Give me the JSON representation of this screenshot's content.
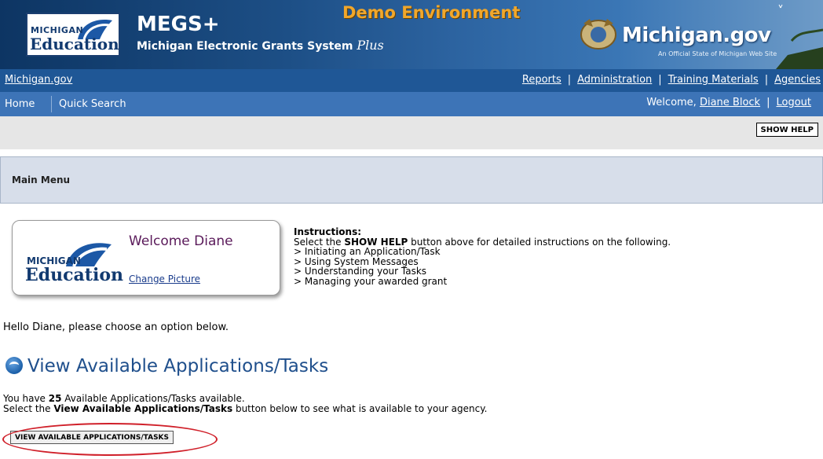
{
  "banner": {
    "mde_logo_top": "MICHIGAN",
    "mde_logo_bottom": "Education",
    "app_title": "MEGS+",
    "app_subtitle": "Michigan Electronic Grants System",
    "app_subtitle_plus": "Plus",
    "environment": "Demo Environment",
    "michigan_gov_logo": "Michigan.gov",
    "michigan_gov_tagline": "An Official State of Michigan Web Site"
  },
  "topnav": {
    "left_link": "Michigan.gov",
    "links": [
      "Reports",
      "Administration",
      "Training Materials",
      "Agencies"
    ],
    "separator": "|"
  },
  "subnav": {
    "home": "Home",
    "quick_search": "Quick Search",
    "welcome_prefix": "Welcome,",
    "user_name": "Diane Block",
    "logout": "Logout",
    "separator": "|"
  },
  "help": {
    "show_help_label": "SHOW HELP"
  },
  "main_menu": {
    "title": "Main Menu"
  },
  "welcome_card": {
    "logo_top": "MICHIGAN",
    "logo_bottom": "Education",
    "greeting": "Welcome Diane",
    "change_picture": "Change Picture"
  },
  "instructions": {
    "heading": "Instructions:",
    "line_pre": "Select the ",
    "line_bold": "SHOW HELP",
    "line_post": " button above for detailed instructions on the following.",
    "items": [
      "> Initiating an Application/Task",
      "> Using System Messages",
      "> Understanding your Tasks",
      "> Managing your awarded grant"
    ]
  },
  "hello_text": "Hello Diane, please choose an option below.",
  "available": {
    "heading": "View Available Applications/Tasks",
    "line1_pre": "You have ",
    "count": "25",
    "line1_post": " Available Applications/Tasks available.",
    "line2_pre": "Select the ",
    "line2_bold": "View Available Applications/Tasks",
    "line2_post": " button below to see what is available to your agency.",
    "button_label": "VIEW AVAILABLE APPLICATIONS/TASKS"
  }
}
